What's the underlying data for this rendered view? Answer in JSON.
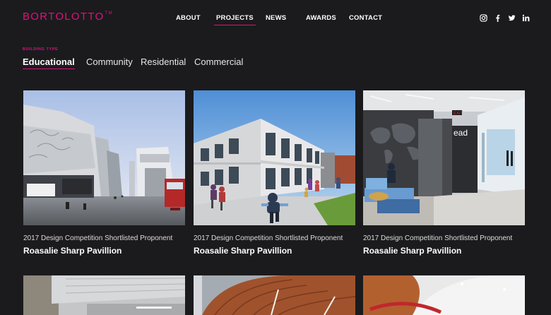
{
  "brand": {
    "name": "BORTOLOTTO",
    "mark": "TM",
    "accent": "#e0117f"
  },
  "nav": {
    "about": "ABOUT",
    "projects": "PROJECTS",
    "news": "NEWS",
    "awards": "AWARDS",
    "contact": "CONTACT",
    "active": "PROJECTS"
  },
  "social": [
    "instagram-icon",
    "facebook-icon",
    "twitter-icon",
    "linkedin-icon"
  ],
  "filters": {
    "label": "BUILDING TYPE",
    "items": [
      "Educational",
      "Community",
      "Residential",
      "Commercial"
    ],
    "active": "Educational"
  },
  "projects": [
    {
      "subtitle": "2017 Design Competition Shortlisted Proponent",
      "title": "Roasalie Sharp Pavillion"
    },
    {
      "subtitle": "2017 Design Competition Shortlisted Proponent",
      "title": "Roasalie Sharp Pavillion"
    },
    {
      "subtitle": "2017 Design Competition Shortlisted Proponent",
      "title": "Roasalie Sharp Pavillion"
    }
  ],
  "image_text": {
    "exit_sign": "EXIT",
    "wall_text": "ead"
  }
}
